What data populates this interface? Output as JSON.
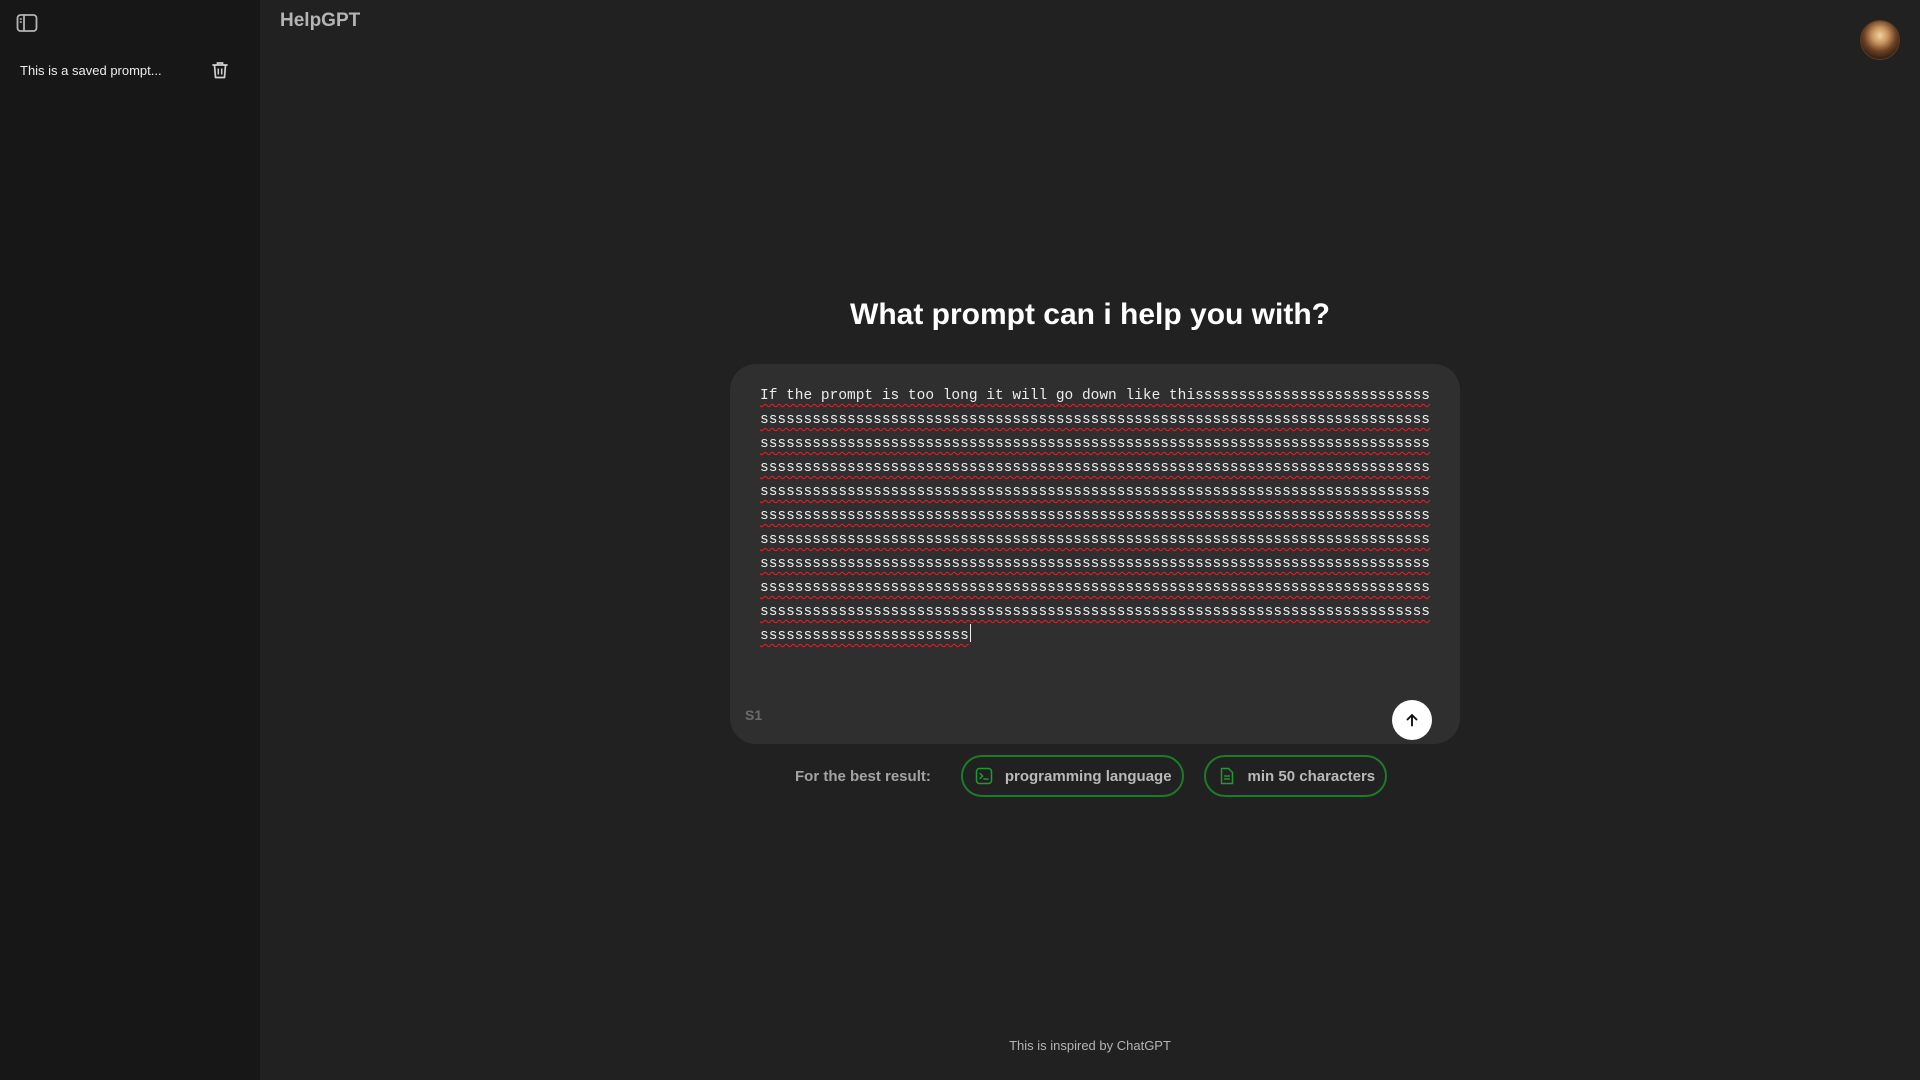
{
  "sidebar": {
    "toggle_icon": "sidebar-toggle-icon",
    "saved_prompts": [
      {
        "label": "This is a saved prompt...",
        "delete_icon": "trash-icon"
      }
    ]
  },
  "header": {
    "title": "HelpGPT",
    "avatar": "user-avatar"
  },
  "main": {
    "headline": "What prompt can i help you with?",
    "composer": {
      "prompt_value": "If the prompt is too long it will go down like thissssssssssssssssssssssssssssssssssssssssssssssssssssssssssssssssssssssssssssssssssssssssssssssssssssssssssssssssssssssssssssssssssssssssssssssssssssssssssssssssssssssssssssssssssssssssssssssssssssssssssssssssssssssssssssssssssssssssssssssssssssssssssssssssssssssssssssssssssssssssssssssssssssssssssssssssssssssssssssssssssssssssssssssssssssssssssssssssssssssssssssssssssssssssssssssssssssssssssssssssssssssssssssssssssssssssssssssssssssssssssssssssssssssssssssssssssssssssssssssssssssssssssssssssssssssssssssssssssssssssssssssssssssssssssssssssssssssssssssssssssssssssssssssssssssssssssssssssssssssssssssssssssssssssssssssssssssssssssssssssssssssssssssssssssssssssssssssssssssssssssssssssssssssssssssssssssssssssssssssssssssssssssssssssssssssss",
      "counter": "S1",
      "send_icon": "arrow-up-icon"
    },
    "hints": {
      "label": "For the best result:",
      "chips": [
        {
          "label": "programming language",
          "icon": "terminal-icon"
        },
        {
          "label": "min 50 characters",
          "icon": "document-icon"
        }
      ]
    }
  },
  "footer": {
    "text": "This is inspired by ChatGPT"
  },
  "colors": {
    "background": "#212121",
    "sidebar": "#171717",
    "composer": "#2f2f2f",
    "accent_green": "#1e7a28",
    "spellcheck_red": "#d9262f"
  }
}
